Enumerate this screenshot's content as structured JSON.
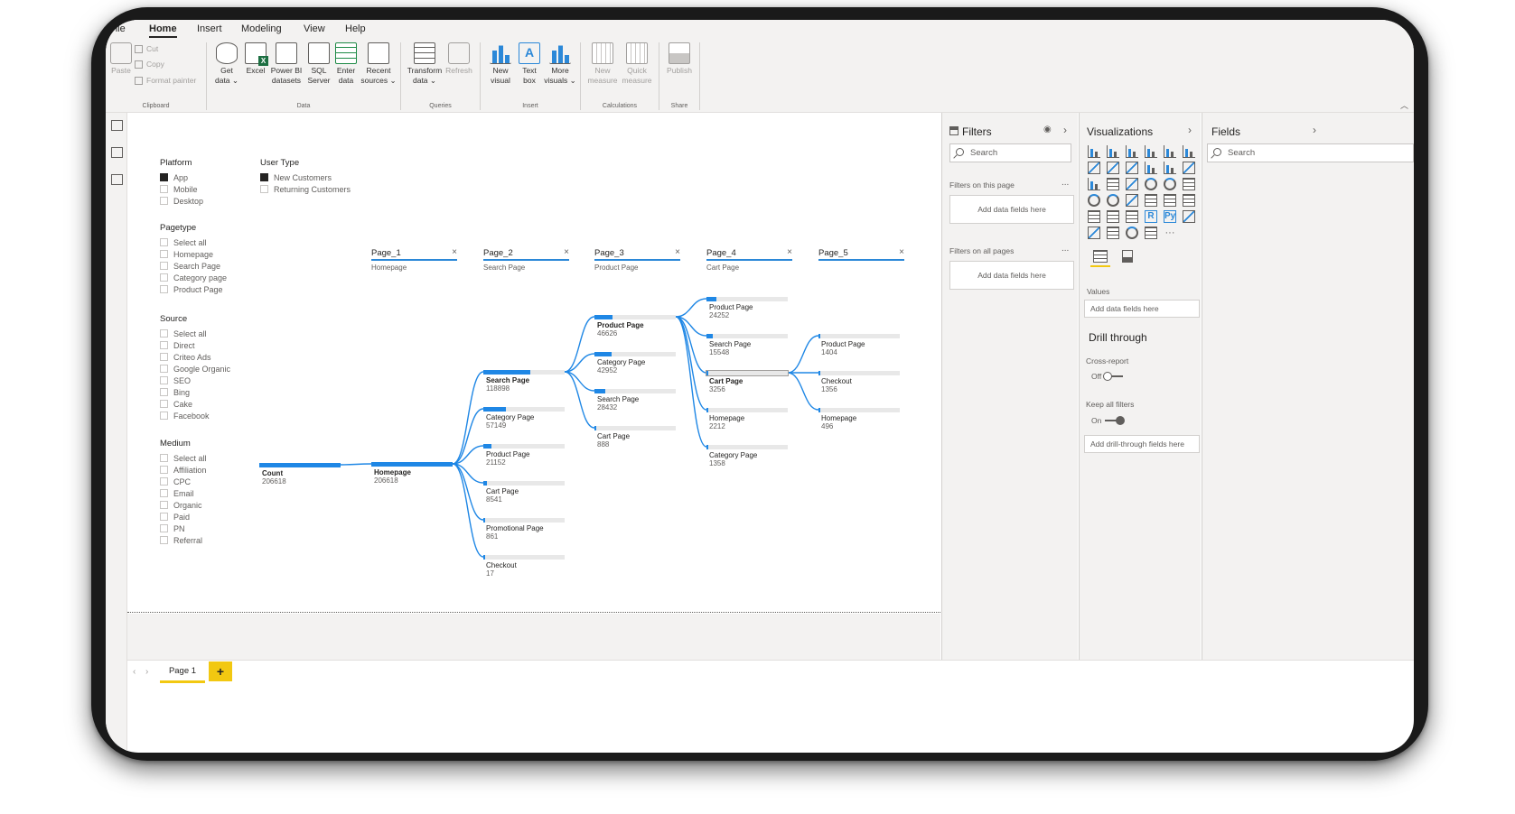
{
  "ribbon": {
    "tabs": [
      "File",
      "Home",
      "Insert",
      "Modeling",
      "View",
      "Help"
    ],
    "active_tab": "Home",
    "clipboard": {
      "paste": "Paste",
      "cut": "Cut",
      "copy": "Copy",
      "format_painter": "Format painter",
      "label": "Clipboard"
    },
    "data": {
      "get_data": "Get\ndata ⌄",
      "excel": "Excel",
      "powerbi": "Power BI\ndatasets",
      "sql": "SQL\nServer",
      "enter": "Enter\ndata",
      "recent": "Recent\nsources ⌄",
      "label": "Data"
    },
    "queries": {
      "transform": "Transform\ndata ⌄",
      "refresh": "Refresh",
      "label": "Queries"
    },
    "insert": {
      "new_visual": "New\nvisual",
      "text_box": "Text\nbox",
      "more_visuals": "More\nvisuals ⌄",
      "label": "Insert"
    },
    "calculations": {
      "new_measure": "New\nmeasure",
      "quick_measure": "Quick\nmeasure",
      "label": "Calculations"
    },
    "share": {
      "publish": "Publish",
      "label": "Share"
    }
  },
  "slicers": {
    "platform": {
      "title": "Platform",
      "items": [
        {
          "label": "App",
          "checked": true
        },
        {
          "label": "Mobile",
          "checked": false
        },
        {
          "label": "Desktop",
          "checked": false
        }
      ]
    },
    "user_type": {
      "title": "User Type",
      "items": [
        {
          "label": "New Customers",
          "checked": true
        },
        {
          "label": "Returning Customers",
          "checked": false
        }
      ]
    },
    "pagetype": {
      "title": "Pagetype",
      "items": [
        {
          "label": "Select all",
          "checked": false
        },
        {
          "label": "Homepage",
          "checked": false
        },
        {
          "label": "Search Page",
          "checked": false
        },
        {
          "label": "Category page",
          "checked": false
        },
        {
          "label": "Product Page",
          "checked": false
        }
      ]
    },
    "source": {
      "title": "Source",
      "items": [
        {
          "label": "Select all",
          "checked": false
        },
        {
          "label": "Direct",
          "checked": false
        },
        {
          "label": "Criteo Ads",
          "checked": false
        },
        {
          "label": "Google Organic",
          "checked": false
        },
        {
          "label": "SEO",
          "checked": false
        },
        {
          "label": "Bing",
          "checked": false
        },
        {
          "label": "Cake",
          "checked": false
        },
        {
          "label": "Facebook",
          "checked": false
        }
      ]
    },
    "medium": {
      "title": "Medium",
      "items": [
        {
          "label": "Select all",
          "checked": false
        },
        {
          "label": "Affiliation",
          "checked": false
        },
        {
          "label": "CPC",
          "checked": false
        },
        {
          "label": "Email",
          "checked": false
        },
        {
          "label": "Organic",
          "checked": false
        },
        {
          "label": "Paid",
          "checked": false
        },
        {
          "label": "PN",
          "checked": false
        },
        {
          "label": "Referral",
          "checked": false
        }
      ]
    }
  },
  "tree": {
    "max_value": 206618,
    "columns": [
      {
        "label": "Page_1",
        "sub": "Homepage",
        "close": "×"
      },
      {
        "label": "Page_2",
        "sub": "Search Page",
        "close": "×"
      },
      {
        "label": "Page_3",
        "sub": "Product Page",
        "close": "×"
      },
      {
        "label": "Page_4",
        "sub": "Cart Page",
        "close": "×"
      },
      {
        "label": "Page_5",
        "sub": "",
        "close": "×"
      }
    ],
    "root": {
      "label": "Count",
      "value": 206618,
      "display": "206618"
    },
    "levels": [
      [
        {
          "label": "Homepage",
          "value": 206618,
          "display": "206618",
          "expanded": true
        }
      ],
      [
        {
          "label": "Search Page",
          "value": 118898,
          "display": "118898",
          "expanded": true
        },
        {
          "label": "Category Page",
          "value": 57149,
          "display": "57149"
        },
        {
          "label": "Product Page",
          "value": 21152,
          "display": "21152"
        },
        {
          "label": "Cart Page",
          "value": 8541,
          "display": "8541"
        },
        {
          "label": "Promotional Page",
          "value": 861,
          "display": "861"
        },
        {
          "label": "Checkout",
          "value": 17,
          "display": "17"
        }
      ],
      [
        {
          "label": "Product Page",
          "value": 46626,
          "display": "46626",
          "expanded": true
        },
        {
          "label": "Category Page",
          "value": 42952,
          "display": "42952"
        },
        {
          "label": "Search Page",
          "value": 28432,
          "display": "28432"
        },
        {
          "label": "Cart Page",
          "value": 888,
          "display": "888"
        }
      ],
      [
        {
          "label": "Product Page",
          "value": 24252,
          "display": "24252"
        },
        {
          "label": "Search Page",
          "value": 15548,
          "display": "15548"
        },
        {
          "label": "Cart Page",
          "value": 3256,
          "display": "3256",
          "expanded": true
        },
        {
          "label": "Homepage",
          "value": 2212,
          "display": "2212"
        },
        {
          "label": "Category Page",
          "value": 1358,
          "display": "1358"
        }
      ],
      [
        {
          "label": "Product Page",
          "value": 1404,
          "display": "1404"
        },
        {
          "label": "Checkout",
          "value": 1356,
          "display": "1356"
        },
        {
          "label": "Homepage",
          "value": 496,
          "display": "496"
        }
      ]
    ]
  },
  "pages": {
    "tab": "Page 1",
    "add": "+",
    "prev": "‹",
    "next": "›"
  },
  "filters": {
    "title": "Filters",
    "search": "Search",
    "on_page": "Filters on this page",
    "on_all": "Filters on all pages",
    "drop": "Add data fields here",
    "more": "...",
    "chevron": "›"
  },
  "visualizations": {
    "title": "Visualizations",
    "chevron": "›",
    "values_label": "Values",
    "values_drop": "Add data fields here",
    "drill_title": "Drill through",
    "cross_report": "Cross-report",
    "cross_state": "Off",
    "keep_filters": "Keep all filters",
    "keep_state": "On",
    "drill_drop": "Add drill-through fields here",
    "r_label": "R",
    "py_label": "Py",
    "more": "···"
  },
  "fields": {
    "title": "Fields",
    "search": "Search",
    "chevron": "›"
  },
  "colors": {
    "accent": "#1f87e5",
    "tab_yellow": "#f2c811",
    "pane_bg": "#f3f2f1"
  }
}
